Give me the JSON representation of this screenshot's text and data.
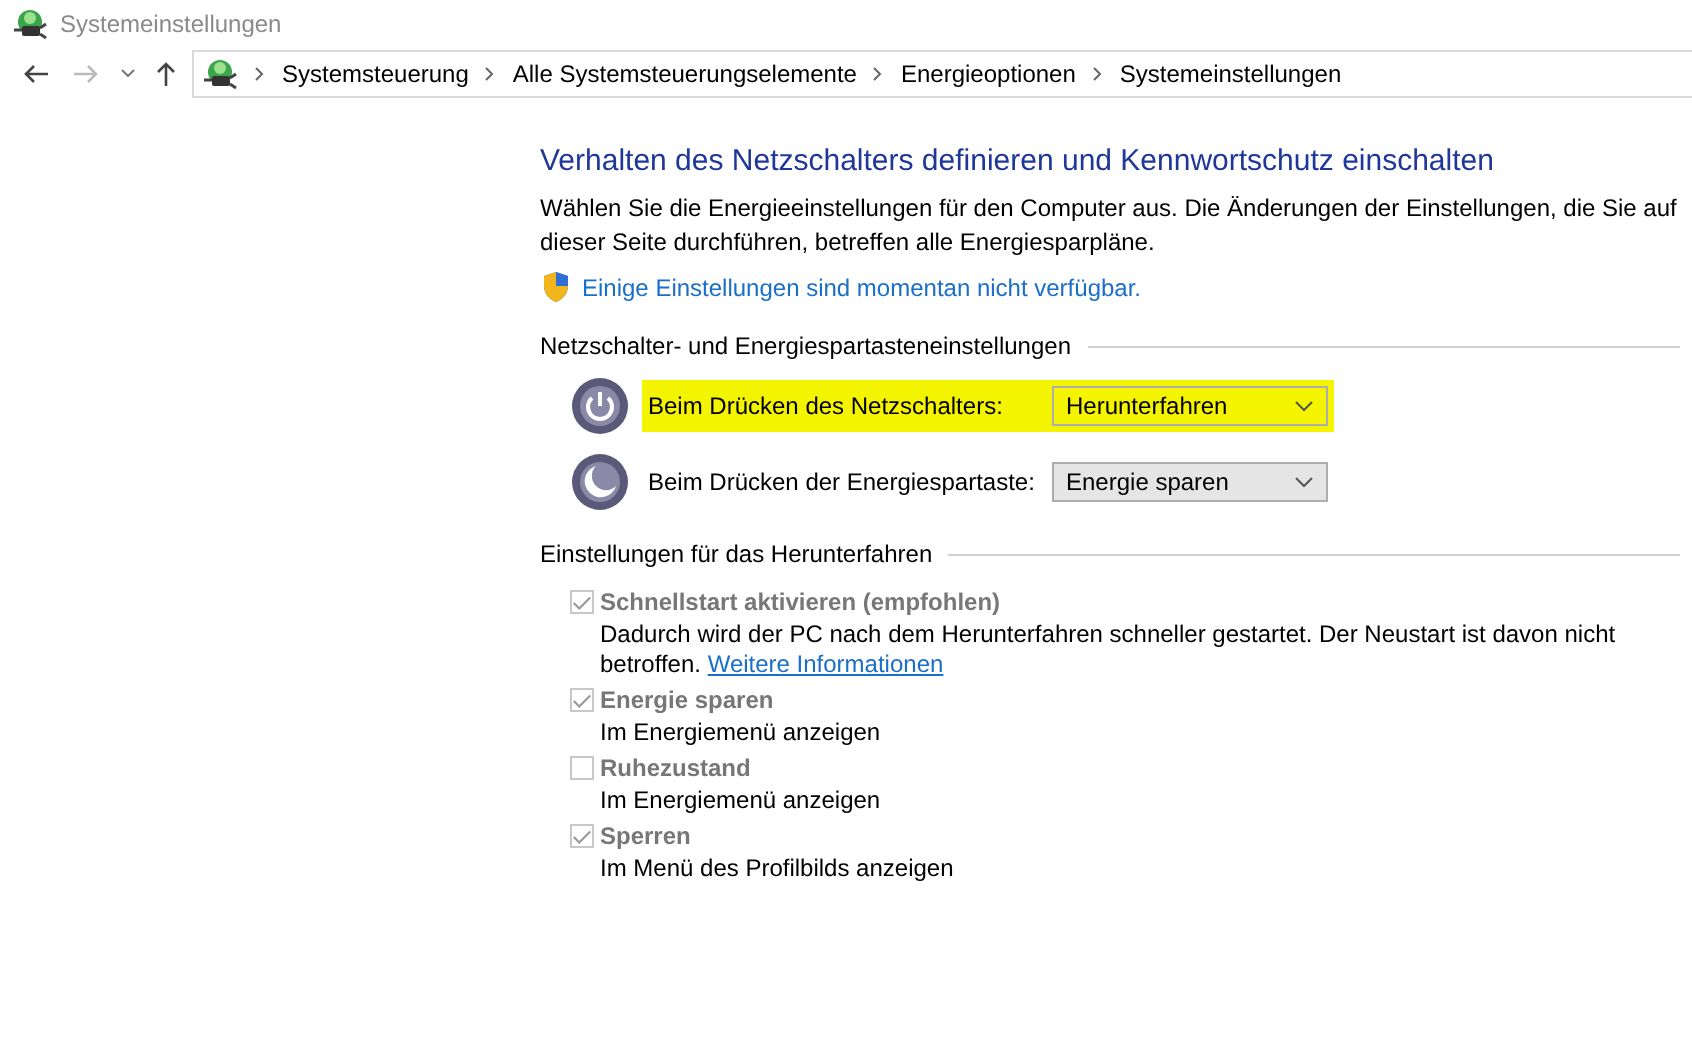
{
  "window": {
    "title": "Systemeinstellungen"
  },
  "breadcrumb": [
    "Systemsteuerung",
    "Alle Systemsteuerungselemente",
    "Energieoptionen",
    "Systemeinstellungen"
  ],
  "heading": "Verhalten des Netzschalters definieren und Kennwortschutz einschalten",
  "intro": "Wählen Sie die Energieeinstellungen für den Computer aus. Die Änderungen der Einstellungen, die Sie auf dieser Seite durchführen, betreffen alle Energiesparpläne.",
  "admin_link": "Einige Einstellungen sind momentan nicht verfügbar.",
  "button_section": {
    "title": "Netzschalter- und Energiespartasteneinstellungen",
    "rows": [
      {
        "kind": "power",
        "label": "Beim Drücken des Netzschalters:",
        "value": "Herunterfahren",
        "highlighted": true
      },
      {
        "kind": "sleep",
        "label": "Beim Drücken der Energiespartaste:",
        "value": "Energie sparen",
        "highlighted": false
      }
    ]
  },
  "shutdown_section": {
    "title": "Einstellungen für das Herunterfahren",
    "options": [
      {
        "label": "Schnellstart aktivieren (empfohlen)",
        "checked": true,
        "disabled": true,
        "description": "Dadurch wird der PC nach dem Herunterfahren schneller gestartet. Der Neustart ist davon nicht betroffen.",
        "link": "Weitere Informationen"
      },
      {
        "label": "Energie sparen",
        "checked": true,
        "disabled": true,
        "description": "Im Energiemenü anzeigen"
      },
      {
        "label": "Ruhezustand",
        "checked": false,
        "disabled": true,
        "description": "Im Energiemenü anzeigen"
      },
      {
        "label": "Sperren",
        "checked": true,
        "disabled": true,
        "description": "Im Menü des Profilbilds anzeigen"
      }
    ]
  }
}
